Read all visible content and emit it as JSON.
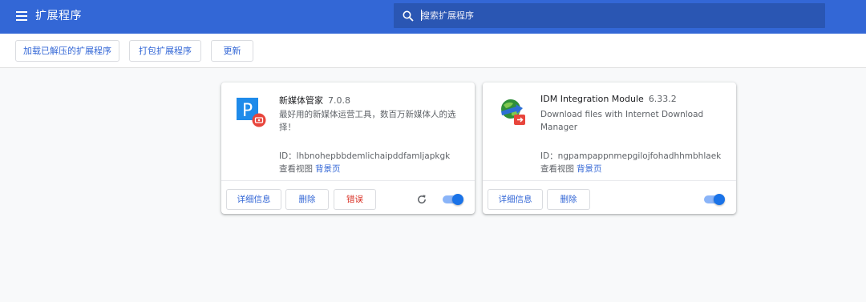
{
  "header": {
    "title": "扩展程序",
    "search_placeholder": "搜索扩展程序"
  },
  "toolbar": {
    "load_unpacked": "加载已解压的扩展程序",
    "pack": "打包扩展程序",
    "update": "更新"
  },
  "extensions": [
    {
      "name": "新媒体管家",
      "version": "7.0.8",
      "description": "最好用的新媒体运营工具，数百万新媒体人的选择！",
      "id_label": "ID：lhbnohepbbdemlichaipddfamljapkgk",
      "views_label": "查看视图",
      "views_link": "背景页",
      "details": "详细信息",
      "remove": "删除",
      "errors": "错误",
      "enabled": true,
      "icon": "new-media-manager-icon",
      "icon_letter": "P"
    },
    {
      "name": "IDM Integration Module",
      "version": "6.33.2",
      "description": "Download files with Internet Download Manager",
      "id_label": "ID：ngpampappnmepgilojfohadhhmbhlaek",
      "views_label": "查看视图",
      "views_link": "背景页",
      "details": "详细信息",
      "remove": "删除",
      "enabled": true,
      "icon": "idm-globe-icon"
    }
  ],
  "colors": {
    "header_bg": "#3367d6",
    "search_bg": "#2a56b3",
    "accent": "#1a73e8",
    "error": "#d93025"
  }
}
